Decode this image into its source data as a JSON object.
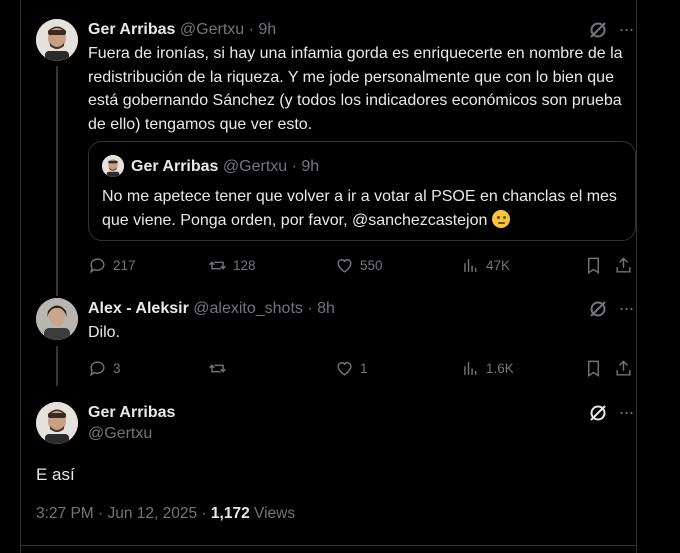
{
  "tweet1": {
    "name": "Ger Arribas",
    "handle": "@Gertxu",
    "time": "· 9h",
    "text": "Fuera de ironías, si hay una infamia gorda es enriquecerte en nombre de la redistribución de la riqueza. Y me jode personalmente que con lo bien que está gobernando Sánchez (y todos los indicadores económicos son prueba de ello) tengamos que ver esto.",
    "quote": {
      "name": "Ger Arribas",
      "handle": "@Gertxu",
      "time": "· 9h",
      "text": "No me apetece tener que volver a ir a votar al PSOE en chanclas el mes que viene. Ponga orden, por favor, @sanchezcastejon"
    },
    "actions": {
      "replies": "217",
      "reposts": "128",
      "likes": "550",
      "views": "47K"
    }
  },
  "tweet2": {
    "name": "Alex - Aleksir",
    "handle": "@alexito_shots",
    "time": "· 8h",
    "text": "Dilo.",
    "actions": {
      "replies": "3",
      "reposts": "",
      "likes": "1",
      "views": "1.6K"
    }
  },
  "tweet3": {
    "name": "Ger Arribas",
    "handle": "@Gertxu",
    "text": "E así",
    "timestamp": "3:27 PM · Jun 12, 2025 · ",
    "views_count": "1,172",
    "views_label": " Views"
  },
  "colors": {
    "background": "#000000",
    "text": "#e7e9ea",
    "muted": "#71767b",
    "border": "#2f3336"
  }
}
